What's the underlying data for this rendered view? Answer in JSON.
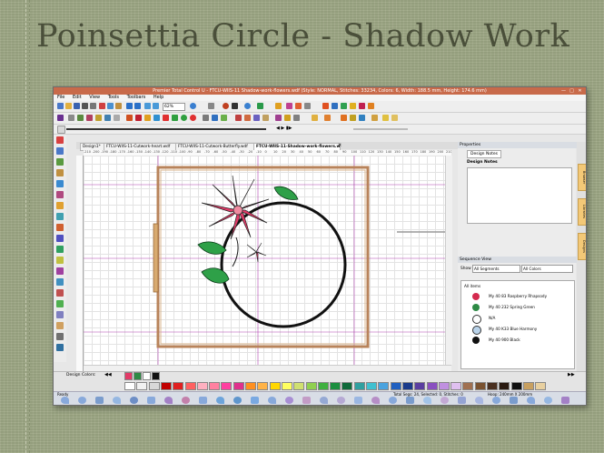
{
  "slide": {
    "title": "Poinsettia Circle - Shadow Work"
  },
  "app": {
    "window_title": "Premier Total Control U - FTCU-WIIS-11 Shadow-work-flowers.wdf (Style: NORMAL, Stitches: 33234, Colors: 6, Width: 188.5 mm, Height: 174.6 mm)",
    "controls": [
      "—",
      "□",
      "✕"
    ],
    "menu": [
      "File",
      "Edit",
      "View",
      "Tools",
      "Toolbars",
      "Help"
    ],
    "zoom": "62%",
    "tabs": [
      {
        "label": "Design1*"
      },
      {
        "label": "FTCU-WIIS-11-Cutwork-heart.wdf"
      },
      {
        "label": "FTCU-WIIS-11-Cutwork-Butterfly.wdf"
      },
      {
        "label": "FTCU-WIIS-11-Shadow-work-flowers.wdf",
        "active": true
      }
    ],
    "ruler_labels": [
      "-210",
      "-200",
      "-190",
      "-180",
      "-170",
      "-160",
      "-150",
      "-140",
      "-130",
      "-120",
      "-110",
      "-100",
      "-90",
      "-80",
      "-70",
      "-60",
      "-50",
      "-40",
      "-30",
      "-20",
      "-10",
      "0",
      "10",
      "20",
      "30",
      "40",
      "50",
      "60",
      "70",
      "80",
      "90",
      "100",
      "110",
      "120",
      "130",
      "140",
      "150",
      "160",
      "170",
      "180",
      "190",
      "200",
      "210"
    ],
    "properties": {
      "header": "Properties",
      "tab": "Design Notes",
      "section": "Design Notes"
    },
    "side_tabs": [
      "Browser",
      "Libraries",
      "Designs"
    ],
    "sequence": {
      "header": "Sequence View",
      "show_label": "Show",
      "segments_select": "All Segments",
      "colors_select": "All Colors",
      "all_items": "All items",
      "items": [
        {
          "label": "My 40 83 Raspberry Rhapsody",
          "color": "#d42a4e"
        },
        {
          "label": "My 40 232 Spring Green",
          "color": "#2e8a45"
        },
        {
          "label": "N/A",
          "color": "#ffffff"
        },
        {
          "label": "My 40 K33 Blue Harmony",
          "color": "#b9d3ea"
        },
        {
          "label": "My 40 900 Black",
          "color": "#111111"
        }
      ]
    },
    "design_colors_label": "Design Colors:",
    "design_colors": [
      "#e23b68",
      "#2e8a45",
      "#ffffff",
      "#111111"
    ],
    "palette": [
      "#ffffff",
      "#f2f2f2",
      "#d8d8d8",
      "#c00000",
      "#e02020",
      "#ff6060",
      "#ffb0c0",
      "#ff80a0",
      "#ff40a0",
      "#e0308c",
      "#ff9020",
      "#ffb347",
      "#ffd700",
      "#ffff60",
      "#d0e070",
      "#90d050",
      "#40b040",
      "#1b8e3e",
      "#0f6a3a",
      "#30a0a0",
      "#40c0d0",
      "#4aa3df",
      "#2060c0",
      "#1a3a8a",
      "#5a3ea0",
      "#8a50c0",
      "#c090e0",
      "#e0c0f0",
      "#a07050",
      "#7a5230",
      "#4a3020",
      "#2a1a10",
      "#101010",
      "#c8a060",
      "#e8d0a0"
    ],
    "status": {
      "left": "Ready",
      "total": "Total Segs: 24, Selected: 0, Stitches: 0",
      "hoop": "Hoop: 240mm X 200mm"
    }
  }
}
